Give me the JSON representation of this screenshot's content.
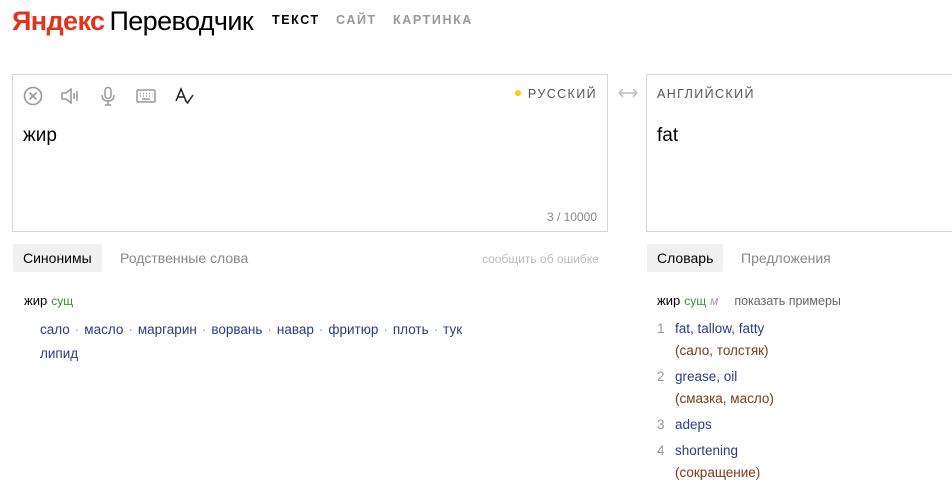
{
  "header": {
    "logo_part1": "Яндекс",
    "logo_part2": "Переводчик",
    "nav": [
      {
        "label": "ТЕКСТ",
        "active": true
      },
      {
        "label": "САЙТ",
        "active": false
      },
      {
        "label": "КАРТИНКА",
        "active": false
      }
    ]
  },
  "source": {
    "language": "РУССКИЙ",
    "text": "жир",
    "char_count": "3 / 10000",
    "toolbar_icons": [
      "clear-icon",
      "speaker-icon",
      "microphone-icon",
      "keyboard-icon",
      "spellcheck-icon"
    ]
  },
  "swap_icon": "swap-arrows-icon",
  "target": {
    "language": "АНГЛИЙСКИЙ",
    "text": "fat"
  },
  "left_tabs": [
    {
      "label": "Синонимы",
      "active": true
    },
    {
      "label": "Родственные слова",
      "active": false
    }
  ],
  "report_error": "сообщить об ошибке",
  "right_tabs": [
    {
      "label": "Словарь",
      "active": true
    },
    {
      "label": "Предложения",
      "active": false
    }
  ],
  "synonyms": {
    "word": "жир",
    "pos": "сущ",
    "items": [
      "сало",
      "масло",
      "маргарин",
      "ворвань",
      "навар",
      "фритюр",
      "плоть",
      "тук",
      "липид"
    ]
  },
  "dictionary": {
    "word": "жир",
    "pos": "сущ",
    "gender": "м",
    "show_examples": "показать примеры",
    "entries": [
      {
        "num": "1",
        "translation": "fat, tallow, fatty",
        "meaning": "(сало, толстяк)"
      },
      {
        "num": "2",
        "translation": "grease, oil",
        "meaning": "(смазка, масло)"
      },
      {
        "num": "3",
        "translation": "adeps",
        "meaning": ""
      },
      {
        "num": "4",
        "translation": "shortening",
        "meaning": "(сокращение)"
      }
    ]
  },
  "colors": {
    "brand_red": "#e5321b",
    "link_blue": "#2c3b83",
    "pos_green": "#3a8a36",
    "meaning_brown": "#7a3b1a",
    "lang_dot": "#ffcc00"
  }
}
